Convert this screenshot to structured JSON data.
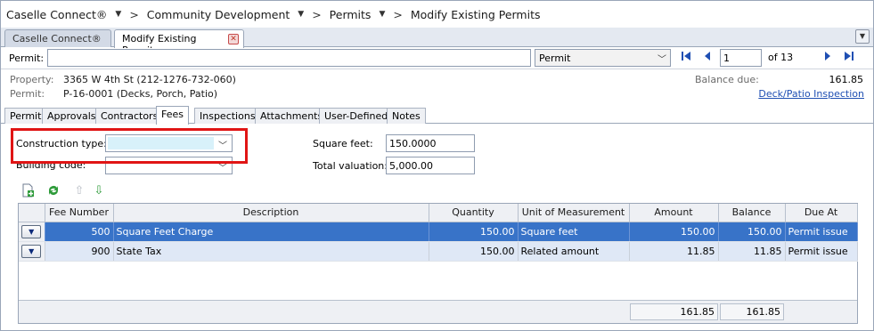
{
  "breadcrumb": {
    "items": [
      "Caselle Connect®",
      "Community Development",
      "Permits",
      "Modify Existing Permits"
    ]
  },
  "doc_tabs": [
    {
      "label": "Caselle Connect®",
      "active": false
    },
    {
      "label": "Modify Existing Permits",
      "active": true
    }
  ],
  "permit_bar": {
    "label": "Permit:",
    "search_value": "",
    "type_selected": "Permit",
    "page_value": "1",
    "page_of": "of 13"
  },
  "info": {
    "property_label": "Property:",
    "property_value": "3365 W 4th St (212-1276-732-060)",
    "permit_label": "Permit:",
    "permit_value": "P-16-0001 (Decks, Porch, Patio)",
    "balance_label": "Balance due:",
    "balance_value": "161.85",
    "inspection_link": "Deck/Patio Inspection"
  },
  "sub_tabs": [
    "Permit",
    "Approvals",
    "Contractors",
    "Fees",
    "Inspections",
    "Attachments",
    "User-Defined",
    "Notes"
  ],
  "active_sub_tab": "Fees",
  "fees_form": {
    "construction_type_label": "Construction type:",
    "construction_type_value": "",
    "building_code_label": "Building code:",
    "building_code_value": "",
    "square_feet_label": "Square feet:",
    "square_feet_value": "150.0000",
    "total_valuation_label": "Total valuation:",
    "total_valuation_value": "5,000.00"
  },
  "grid": {
    "columns": [
      "Fee Number",
      "Description",
      "Quantity",
      "Unit of Measurement",
      "Amount",
      "Balance",
      "Due At"
    ],
    "rows": [
      {
        "fee_number": "500",
        "description": "Square Feet Charge",
        "quantity": "150.00",
        "unit": "Square feet",
        "amount": "150.00",
        "balance": "150.00",
        "due_at": "Permit issue",
        "selected": true
      },
      {
        "fee_number": "900",
        "description": "State Tax",
        "quantity": "150.00",
        "unit": "Related amount",
        "amount": "11.85",
        "balance": "11.85",
        "due_at": "Permit issue",
        "selected": false
      }
    ],
    "total_amount": "161.85",
    "total_balance": "161.85"
  },
  "colors": {
    "highlight": "#e01515",
    "selected_row": "#3873c8",
    "link": "#1f4fb3"
  }
}
